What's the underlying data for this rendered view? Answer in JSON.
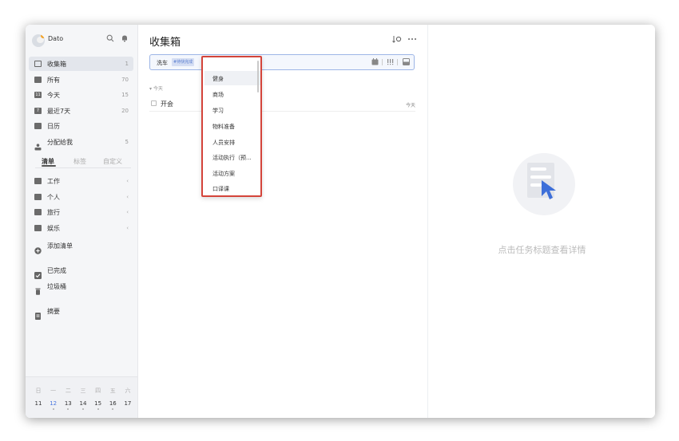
{
  "app": {
    "username": "Dato"
  },
  "sidebar": {
    "items": [
      {
        "label": "收集箱",
        "count": "1"
      },
      {
        "label": "所有",
        "count": "70"
      },
      {
        "label": "今天",
        "count": "15",
        "icon_text": "11"
      },
      {
        "label": "最近7天",
        "count": "20",
        "icon_text": "7"
      },
      {
        "label": "日历",
        "count": ""
      },
      {
        "label": "分配给我",
        "count": "5"
      }
    ],
    "tabs": [
      "清单",
      "标签",
      "自定义"
    ],
    "lists": [
      {
        "label": "工作",
        "chevron": "‹"
      },
      {
        "label": "个人",
        "chevron": "‹"
      },
      {
        "label": "旅行",
        "chevron": "‹"
      },
      {
        "label": "娱乐",
        "chevron": "‹"
      }
    ],
    "add_list": "添加清单",
    "completed": "已完成",
    "trash": "垃圾桶",
    "summary": "摘要",
    "calendar": {
      "weekdays": [
        "日",
        "一",
        "二",
        "三",
        "四",
        "五",
        "六"
      ],
      "dates": [
        "11",
        "12",
        "13",
        "14",
        "15",
        "16",
        "17"
      ],
      "today": "12"
    }
  },
  "main": {
    "title": "收集箱",
    "input": {
      "text": "洗车",
      "tag": "#待快完成",
      "hash": "#"
    },
    "section": "▾  今天",
    "tasks": [
      {
        "title": "开会",
        "date": "今天"
      }
    ]
  },
  "dropdown": {
    "items": [
      "健身",
      "商场",
      "学习",
      "物料准备",
      "人员安排",
      "活动执行（预...",
      "活动方案",
      "口译课"
    ]
  },
  "detail": {
    "empty_text": "点击任务标题查看详情"
  },
  "colors": {
    "accent": "#4a77e0",
    "highlight_border": "#d4443a",
    "sidebar_bg": "#f5f6f8"
  }
}
